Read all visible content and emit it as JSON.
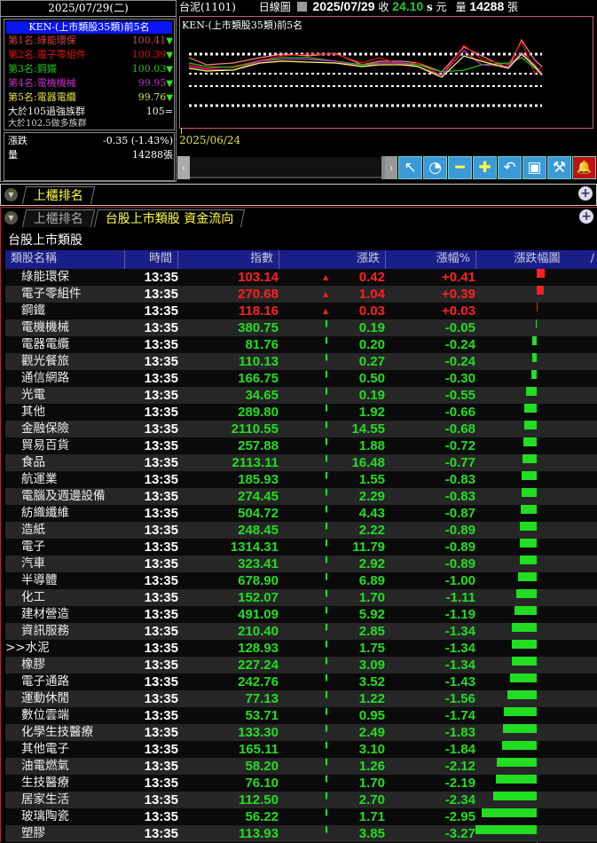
{
  "left": {
    "date": "2025/07/29(二)",
    "rank_title": "KEN-(上市類股35類)前5名",
    "ranks": [
      {
        "label": "第1名:綠能環保",
        "value": "100.41",
        "color": "#d04040"
      },
      {
        "label": "第2名:電子零組件",
        "value": "100.39",
        "color": "#e01010"
      },
      {
        "label": "第3名:鋼鐵",
        "value": "100.03",
        "color": "#20c020"
      },
      {
        "label": "第4名:電機機械",
        "value": "99.95",
        "color": "#c030c0"
      },
      {
        "label": "第5名:電器電纜",
        "value": "99.76",
        "color": "#e0e040"
      }
    ],
    "strong_label": "大於105過強族群",
    "strong_value": "105",
    "bull_label": "大於102.5做多族群",
    "change_label": "漲跌",
    "change_value": "-0.35 (-1.43%)",
    "volume_label": "量",
    "volume_value": "14288張"
  },
  "header": {
    "stock": "台泥(1101)",
    "chart_type": "日線圖",
    "date": "2025/07/29",
    "close_label": "收",
    "close": "24.10",
    "unit_s": "s",
    "unit_yuan": "元",
    "vol_label": "量",
    "volume": "14288",
    "vol_unit": "張"
  },
  "chart": {
    "title": "KEN-(上市類股35類)前5名",
    "start_date": "2025/06/24"
  },
  "toolbar": {
    "icons": [
      "arrow-upleft-icon",
      "clock-icon",
      "minus-icon",
      "plus-icon",
      "undo-icon",
      "fullscreen-icon",
      "wrench-icon",
      "bell-icon"
    ]
  },
  "tabs1": {
    "tab1": "上櫃排名"
  },
  "tabs2": {
    "tab1": "上櫃排名",
    "tab2": "台股上市類股 資金流向"
  },
  "subtitle": "台股上市類股",
  "columns": [
    "類股名稱",
    "時間",
    "指數",
    "漲跌",
    "漲幅%",
    "漲跌幅圖"
  ],
  "colors": {
    "up": "#ff2020",
    "down": "#22dd22"
  },
  "rows": [
    [
      "綠能環保",
      "13:35",
      "103.14",
      "0.42",
      "+0.41"
    ],
    [
      "電子零組件",
      "13:35",
      "270.68",
      "1.04",
      "+0.39"
    ],
    [
      "鋼鐵",
      "13:35",
      "118.16",
      "0.03",
      "+0.03"
    ],
    [
      "電機機械",
      "13:35",
      "380.75",
      "0.19",
      "-0.05"
    ],
    [
      "電器電纜",
      "13:35",
      "81.76",
      "0.20",
      "-0.24"
    ],
    [
      "觀光餐旅",
      "13:35",
      "110.13",
      "0.27",
      "-0.24"
    ],
    [
      "通信網路",
      "13:35",
      "166.75",
      "0.50",
      "-0.30"
    ],
    [
      "光電",
      "13:35",
      "34.65",
      "0.19",
      "-0.55"
    ],
    [
      "其他",
      "13:35",
      "289.80",
      "1.92",
      "-0.66"
    ],
    [
      "金融保險",
      "13:35",
      "2110.55",
      "14.55",
      "-0.68"
    ],
    [
      "貿易百貨",
      "13:35",
      "257.88",
      "1.88",
      "-0.72"
    ],
    [
      "食品",
      "13:35",
      "2113.11",
      "16.48",
      "-0.77"
    ],
    [
      "航運業",
      "13:35",
      "185.93",
      "1.55",
      "-0.83"
    ],
    [
      "電腦及週邊設備",
      "13:35",
      "274.45",
      "2.29",
      "-0.83"
    ],
    [
      "紡織纖維",
      "13:35",
      "504.72",
      "4.43",
      "-0.87"
    ],
    [
      "造紙",
      "13:35",
      "248.45",
      "2.22",
      "-0.89"
    ],
    [
      "電子",
      "13:35",
      "1314.31",
      "11.79",
      "-0.89"
    ],
    [
      "汽車",
      "13:35",
      "323.41",
      "2.92",
      "-0.89"
    ],
    [
      "半導體",
      "13:35",
      "678.90",
      "6.89",
      "-1.00"
    ],
    [
      "化工",
      "13:35",
      "152.07",
      "1.70",
      "-1.11"
    ],
    [
      "建材營造",
      "13:35",
      "491.09",
      "5.92",
      "-1.19"
    ],
    [
      "資訊服務",
      "13:35",
      "210.40",
      "2.85",
      "-1.34"
    ],
    [
      "水泥",
      "13:35",
      "128.93",
      "1.75",
      "-1.34"
    ],
    [
      "橡膠",
      "13:35",
      "227.24",
      "3.09",
      "-1.34"
    ],
    [
      "電子通路",
      "13:35",
      "242.76",
      "3.52",
      "-1.43"
    ],
    [
      "運動休閒",
      "13:35",
      "77.13",
      "1.22",
      "-1.56"
    ],
    [
      "數位雲端",
      "13:35",
      "53.71",
      "0.95",
      "-1.74"
    ],
    [
      "化學生技醫療",
      "13:35",
      "133.30",
      "2.49",
      "-1.83"
    ],
    [
      "其他電子",
      "13:35",
      "165.11",
      "3.10",
      "-1.84"
    ],
    [
      "油電燃氣",
      "13:35",
      "58.20",
      "1.26",
      "-2.12"
    ],
    [
      "生技醫療",
      "13:35",
      "76.10",
      "1.70",
      "-2.19"
    ],
    [
      "居家生活",
      "13:35",
      "112.50",
      "2.70",
      "-2.34"
    ],
    [
      "玻璃陶瓷",
      "13:35",
      "56.22",
      "1.71",
      "-2.95"
    ],
    [
      "塑膠",
      "13:35",
      "113.93",
      "3.85",
      "-3.27"
    ]
  ],
  "selected_marker": ">>",
  "selected_row": 22
}
